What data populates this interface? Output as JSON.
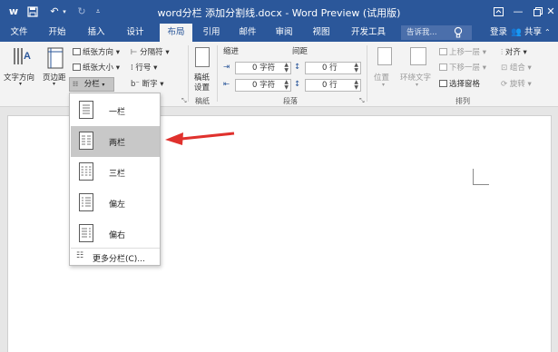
{
  "window": {
    "title": "word分栏 添加分割线.docx - Word Preview (试用版)",
    "qa_icons": [
      "word-logo-icon",
      "save-icon",
      "undo-icon",
      "redo-icon",
      "customize-qa-icon"
    ],
    "controls": [
      "ribbon-display-icon",
      "minimize-icon",
      "restore-icon",
      "close-icon"
    ]
  },
  "tabs": [
    "文件",
    "开始",
    "插入",
    "设计",
    "布局",
    "引用",
    "邮件",
    "审阅",
    "视图",
    "开发工具"
  ],
  "active_tab": "布局",
  "tell_me": {
    "placeholder": "告诉我..."
  },
  "account": {
    "login": "登录",
    "share": "共享"
  },
  "ribbon": {
    "page_setup": {
      "text_direction": "文字方向",
      "margins": "页边距",
      "orientation": "纸张方向",
      "size": "纸张大小",
      "columns": "分栏",
      "breaks": "分隔符",
      "line_numbers": "行号",
      "hyphenation": "断字"
    },
    "draft": {
      "label": "稿纸设置",
      "line1": "稿纸",
      "line2": "设置",
      "group": "稿纸"
    },
    "paragraph": {
      "indent_label": "缩进",
      "spacing_label": "间距",
      "indent_left": "0 字符",
      "indent_right": "0 字符",
      "spacing_before": "0 行",
      "spacing_after": "0 行",
      "group": "段落"
    },
    "arrange": {
      "position": "位置",
      "wrap_text": "环绕文字",
      "bring_forward": "上移一层",
      "send_backward": "下移一层",
      "selection_pane": "选择窗格",
      "align": "对齐",
      "group_obj": "组合",
      "rotate": "旋转",
      "group": "排列"
    }
  },
  "columns_menu": {
    "items": [
      "一栏",
      "两栏",
      "三栏",
      "偏左",
      "偏右"
    ],
    "selected": "两栏",
    "more": "更多分栏(C)..."
  },
  "colors": {
    "accent": "#2b579a",
    "selected_item": "#c8c8c8",
    "arrow": "#e0312d"
  }
}
